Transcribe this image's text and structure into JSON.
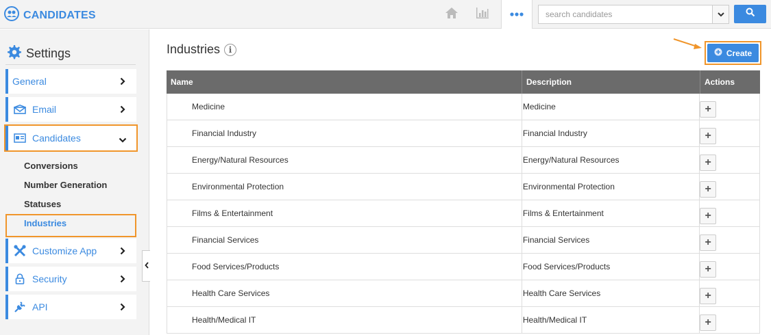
{
  "app": {
    "title": "CANDIDATES"
  },
  "search": {
    "placeholder": "search candidates"
  },
  "sidebar": {
    "heading": "Settings",
    "items": [
      {
        "label": "General"
      },
      {
        "label": "Email"
      },
      {
        "label": "Candidates"
      },
      {
        "label": "Customize App"
      },
      {
        "label": "Security"
      },
      {
        "label": "API"
      }
    ],
    "sub_items": [
      {
        "label": "Conversions"
      },
      {
        "label": "Number Generation"
      },
      {
        "label": "Statuses"
      },
      {
        "label": "Industries"
      }
    ]
  },
  "main": {
    "title": "Industries",
    "create_label": "Create",
    "columns": [
      "Name",
      "Description",
      "Actions"
    ],
    "rows": [
      {
        "name": "Medicine",
        "description": "Medicine"
      },
      {
        "name": "Financial Industry",
        "description": "Financial Industry"
      },
      {
        "name": "Energy/Natural Resources",
        "description": "Energy/Natural Resources"
      },
      {
        "name": "Environmental Protection",
        "description": "Environmental Protection"
      },
      {
        "name": "Films & Entertainment",
        "description": "Films & Entertainment"
      },
      {
        "name": "Financial Services",
        "description": "Financial Services"
      },
      {
        "name": "Food Services/Products",
        "description": "Food Services/Products"
      },
      {
        "name": "Health Care Services",
        "description": "Health Care Services"
      },
      {
        "name": "Health/Medical IT",
        "description": "Health/Medical IT"
      }
    ],
    "row_action_symbol": "+"
  },
  "colors": {
    "accent": "#3b8ae0",
    "highlight": "#f0952a",
    "header_bg": "#6b6b6b"
  },
  "icons": [
    "candidates-logo-icon",
    "home-icon",
    "bar-chart-icon",
    "more-icon",
    "chevron-down-icon",
    "search-icon",
    "gear-icon",
    "chevron-right-icon",
    "envelope-icon",
    "id-card-icon",
    "tools-icon",
    "lock-icon",
    "plug-icon",
    "chevron-left-icon",
    "info-icon",
    "plus-circle-icon",
    "arrow-icon"
  ]
}
